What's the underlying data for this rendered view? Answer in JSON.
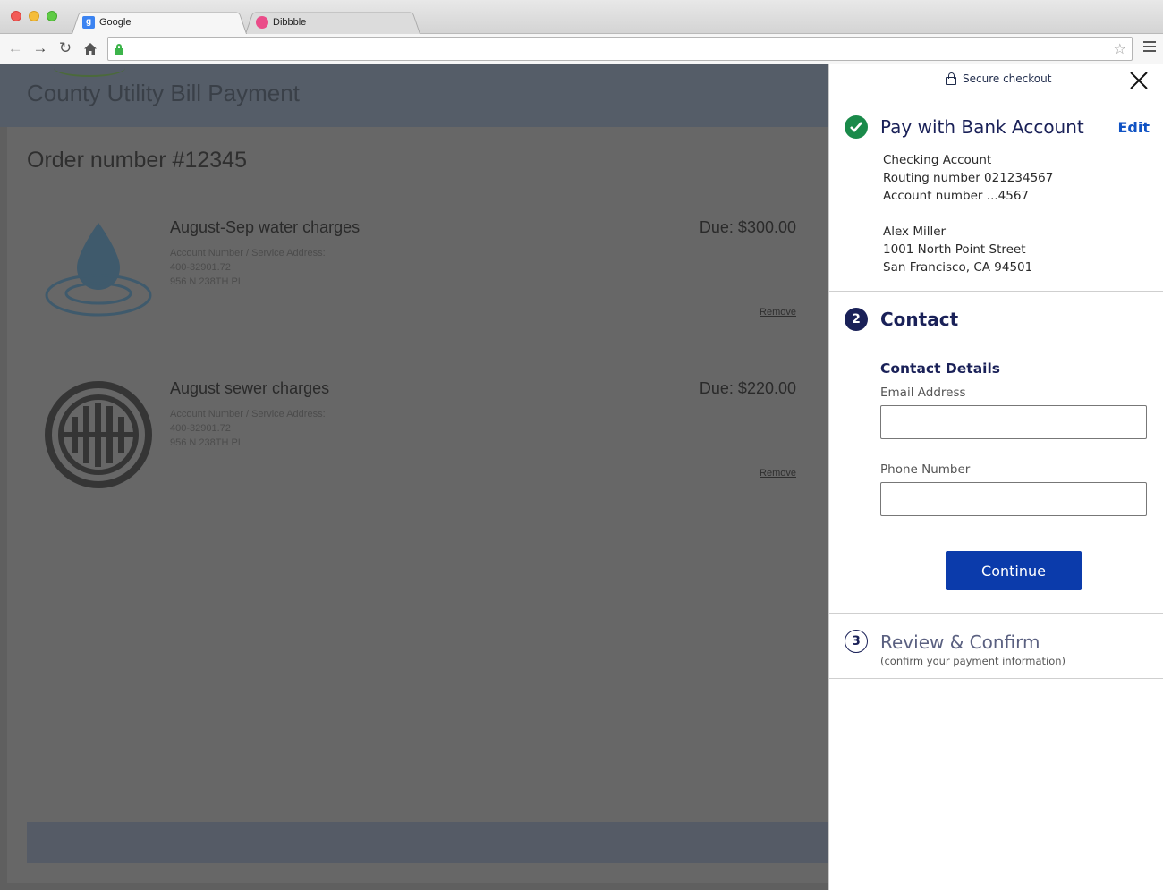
{
  "browser": {
    "tabs": [
      {
        "title": "Google",
        "icon": "google-favicon"
      },
      {
        "title": "Dibbble",
        "icon": "dribbble-favicon"
      }
    ],
    "url": ""
  },
  "page": {
    "title": "County Utility Bill Payment",
    "order_title": "Order number #12345",
    "bills": [
      {
        "name": "August-Sep water charges",
        "due": "Due: $300.00",
        "meta_label": "Account Number / Service Address:",
        "account": "400-32901.72",
        "address": "956 N 238TH PL",
        "remove": "Remove",
        "icon": "water-drop-icon"
      },
      {
        "name": "August sewer charges",
        "due": "Due: $220.00",
        "meta_label": "Account Number / Service Address:",
        "account": "400-32901.72",
        "address": "956 N 238TH PL",
        "remove": "Remove",
        "icon": "sewer-grate-icon"
      }
    ]
  },
  "checkout": {
    "header": "Secure checkout",
    "step1": {
      "title": "Pay with Bank Account",
      "edit": "Edit",
      "account_type": "Checking Account",
      "routing": "Routing number 021234567",
      "account": "Account number ...4567",
      "name": "Alex Miller",
      "street": "1001 North Point Street",
      "city": "San Francisco, CA 94501",
      "status": "complete"
    },
    "step2": {
      "number": "2",
      "title": "Contact",
      "section": "Contact Details",
      "email_label": "Email Address",
      "email_value": "",
      "phone_label": "Phone Number",
      "phone_value": "",
      "continue": "Continue"
    },
    "step3": {
      "number": "3",
      "title": "Review & Confirm",
      "subtitle": "(confirm your payment information)"
    }
  },
  "colors": {
    "accent": "#1a2158",
    "button": "#0b3bab",
    "link": "#1053c4",
    "success": "#1a8a4a"
  }
}
